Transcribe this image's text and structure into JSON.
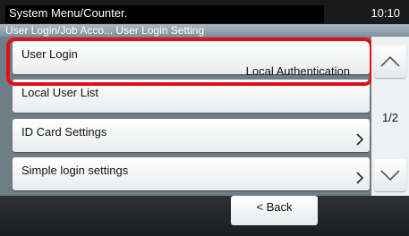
{
  "header": {
    "title": "System Menu/Counter.",
    "time": "10:10"
  },
  "breadcrumb": "User Login/Job Acco...  User Login Setting",
  "items": [
    {
      "label": "User Login",
      "value": "Local Authentication"
    },
    {
      "label": "Local User List",
      "value": ""
    },
    {
      "label": "ID Card Settings",
      "value": ""
    },
    {
      "label": "Simple login settings",
      "value": ""
    }
  ],
  "pager": {
    "current": "1/2"
  },
  "footer": {
    "back_label": "< Back"
  },
  "colors": {
    "highlight": "#e0101a",
    "background": "#6f7d86"
  }
}
